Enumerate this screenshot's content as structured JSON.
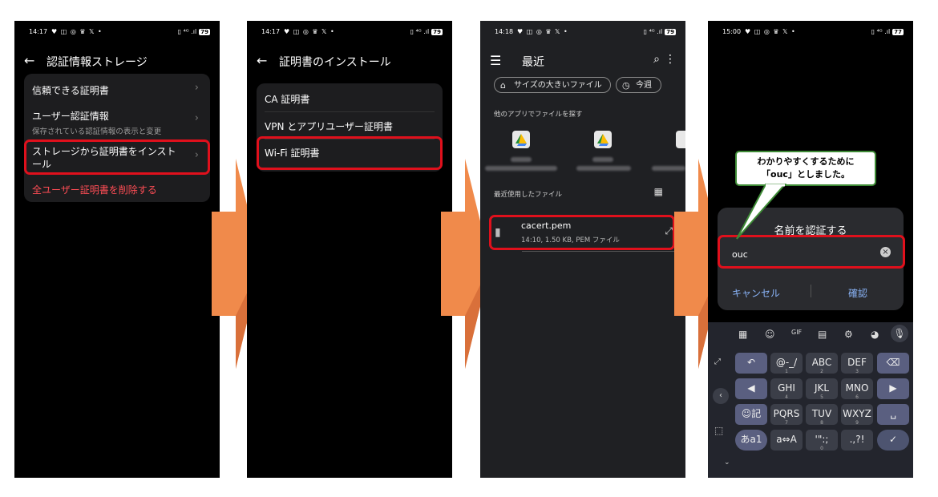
{
  "screens": [
    {
      "status": {
        "time": "14:17",
        "icons": "♥ ◫ ◎ ♛ 𝕏 •",
        "right": "▯ ⁴ᴳ .ıl",
        "battery": "79"
      },
      "title": "認証情報ストレージ",
      "items": [
        {
          "label": "信頼できる証明書"
        },
        {
          "label": "ユーザー認証情報",
          "sub": "保存されている認証情報の表示と変更"
        },
        {
          "label": "ストレージから証明書をインストール"
        },
        {
          "label": "全ユーザー証明書を削除する"
        }
      ]
    },
    {
      "status": {
        "time": "14:17",
        "icons": "♥ ◫ ◎ ♛ 𝕏 •",
        "right": "▯ ⁴ᴳ .ıl",
        "battery": "79"
      },
      "title": "証明書のインストール",
      "items": [
        {
          "label": "CA 証明書"
        },
        {
          "label": "VPN とアプリユーザー証明書"
        },
        {
          "label": "Wi-Fi 証明書"
        }
      ]
    },
    {
      "status": {
        "time": "14:18",
        "icons": "♥ ◫ ◎ ♛ 𝕏 •",
        "right": "▯ ⁴ᴳ .ıl",
        "battery": "79"
      },
      "title": "最近",
      "chips": [
        "サイズの大きいファイル",
        "今週"
      ],
      "other_apps_heading": "他のアプリでファイルを探す",
      "recent_heading": "最近使用したファイル",
      "file": {
        "name": "cacert.pem",
        "meta": "14:10, 1.50 KB, PEM ファイル"
      }
    },
    {
      "status": {
        "time": "15:00",
        "icons": "♥ ◫ ◎ ♛ 𝕏 •",
        "right": "▯ ⁴ᴳ .ıl",
        "battery": "77"
      },
      "callout": [
        "わかりやすくするために",
        "「ouc」としました。"
      ],
      "dialog": {
        "title": "名前を認証する",
        "value": "ouc",
        "cancel": "キャンセル",
        "ok": "確認"
      },
      "keyboard": {
        "toolbar": [
          "▦",
          "☺",
          "GIF",
          "▤",
          "⚙",
          "◕",
          "🎙"
        ],
        "rows": [
          [
            {
              "k": "↶"
            },
            {
              "k": "@-_/",
              "n": "1"
            },
            {
              "k": "ABC",
              "n": "2"
            },
            {
              "k": "DEF",
              "n": "3"
            },
            {
              "k": "⌫"
            }
          ],
          [
            {
              "k": "◀"
            },
            {
              "k": "GHI",
              "n": "4"
            },
            {
              "k": "JKL",
              "n": "5"
            },
            {
              "k": "MNO",
              "n": "6"
            },
            {
              "k": "▶"
            }
          ],
          [
            {
              "k": "☺記"
            },
            {
              "k": "PQRS",
              "n": "7"
            },
            {
              "k": "TUV",
              "n": "8"
            },
            {
              "k": "WXYZ",
              "n": "9"
            },
            {
              "k": "␣"
            }
          ],
          [
            {
              "k": "あa1"
            },
            {
              "k": "a⇔A"
            },
            {
              "k": "'\":;",
              "n": "0"
            },
            {
              "k": ".,?!"
            },
            {
              "k": "✓"
            }
          ]
        ]
      }
    }
  ],
  "colors": {
    "highlight": "#e0101c",
    "arrow": "#f08a4b",
    "callout_border": "#3d8a35",
    "accent_blue": "#8ab4f8",
    "danger": "#ff4d55"
  }
}
